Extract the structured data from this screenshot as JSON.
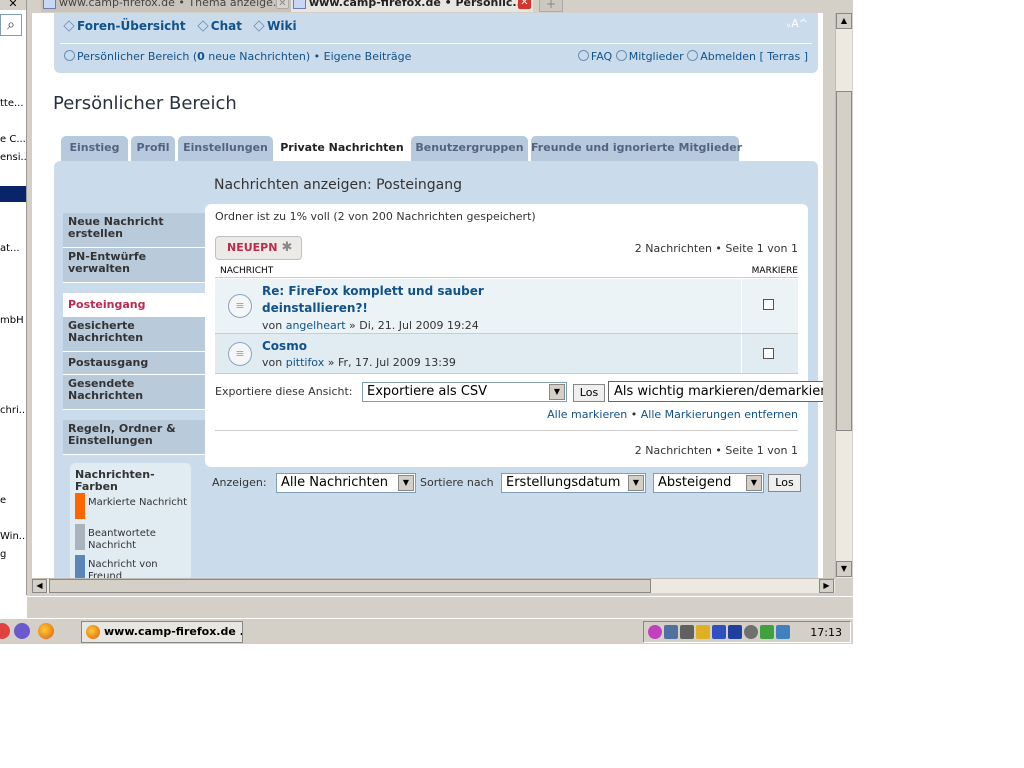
{
  "left_window": {
    "fragments": [
      "tte...",
      "e C...",
      "ensi...",
      "at...",
      "mbH",
      "chri...",
      "e",
      "Win...",
      "g"
    ]
  },
  "browser": {
    "tabs": [
      {
        "label": "www.camp-firefox.de • Thema anzeige..."
      },
      {
        "label": "www.camp-firefox.de • Persönlic..."
      }
    ],
    "new_tab_label": "+"
  },
  "nav": {
    "links": [
      "Foren-Übersicht",
      "Chat",
      "Wiki"
    ],
    "font_size_label": "ᵥA^",
    "personal_area_prefix": "Persönlicher Bereich (",
    "new_messages_count": "0",
    "new_messages_suffix": " neue Nachrichten)",
    "own_posts": "Eigene Beiträge",
    "faq": "FAQ",
    "members": "Mitglieder",
    "logout": "Abmelden [ Terras ]"
  },
  "page_title": "Persönlicher Bereich",
  "tabs": [
    "Einstieg",
    "Profil",
    "Einstellungen",
    "Private Nachrichten",
    "Benutzergruppen",
    "Freunde und ignorierte Mitglieder"
  ],
  "active_tab": "Private Nachrichten",
  "panel_heading": "Nachrichten anzeigen: Posteingang",
  "sidebar": {
    "items": [
      "Neue Nachricht erstellen",
      "PN-Entwürfe verwalten",
      "Posteingang",
      "Gesicherte Nachrichten",
      "Postausgang",
      "Gesendete Nachrichten",
      "Regeln, Ordner & Einstellungen"
    ],
    "active": "Posteingang"
  },
  "colors_box": {
    "title": "Nachrichten-Farben",
    "legend": [
      {
        "label": "Markierte Nachricht",
        "color": "#ff6600"
      },
      {
        "label": "Beantwortete Nachricht",
        "color": "#aab3bd"
      },
      {
        "label": "Nachricht von Freund",
        "color": "#5a86b8"
      }
    ]
  },
  "folder_status": "Ordner ist zu 1% voll (2 von 200 Nachrichten gespeichert)",
  "new_pm_button": "NEUEPN",
  "pagination_text": "2 Nachrichten • Seite 1 von 1",
  "columns": {
    "message": "NACHRICHT",
    "mark": "MARKIERE"
  },
  "messages": [
    {
      "title": "Re: FireFox komplett und sauber deinstallieren?!",
      "by": "von ",
      "author": "angelheart",
      "date": " » Di, 21. Jul 2009 19:24"
    },
    {
      "title": "Cosmo",
      "by": "von ",
      "author": "pittifox",
      "date": " » Fr, 17. Jul 2009 13:39"
    }
  ],
  "export": {
    "label": "Exportiere diese Ansicht:",
    "selected": "Exportiere als CSV",
    "go": "Los",
    "action_selected": "Als wichtig markieren/demarkieren"
  },
  "mark_links": {
    "mark_all": "Alle markieren",
    "separator": " • ",
    "unmark_all": "Alle Markierungen entfernen"
  },
  "filters": {
    "show_label": "Anzeigen:",
    "show_selected": "Alle Nachrichten",
    "sort_label": "Sortiere nach",
    "sort_selected": "Erstellungsdatum",
    "order_selected": "Absteigend",
    "go": "Los"
  },
  "taskbar": {
    "window_button": "www.camp-firefox.de ...",
    "clock": "17:13"
  }
}
